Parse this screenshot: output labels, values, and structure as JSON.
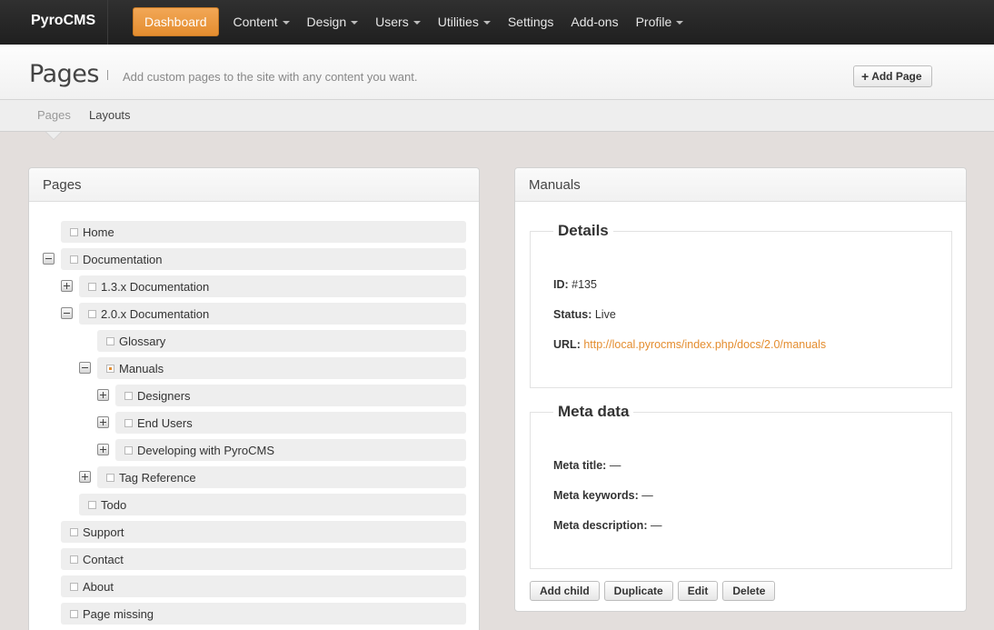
{
  "brand": "PyroCMS",
  "nav": [
    {
      "label": "Dashboard",
      "active": true,
      "caret": false
    },
    {
      "label": "Content",
      "caret": true
    },
    {
      "label": "Design",
      "caret": true
    },
    {
      "label": "Users",
      "caret": true
    },
    {
      "label": "Utilities",
      "caret": true
    },
    {
      "label": "Settings",
      "caret": false
    },
    {
      "label": "Add-ons",
      "caret": false
    },
    {
      "label": "Profile",
      "caret": true
    }
  ],
  "header": {
    "title": "Pages",
    "description": "Add custom pages to the site with any content you want.",
    "add_page_label": "Add Page"
  },
  "subnav": {
    "pages": "Pages",
    "layouts": "Layouts"
  },
  "tree_panel": {
    "title": "Pages",
    "items": [
      {
        "label": "Home",
        "level": 0
      },
      {
        "label": "Documentation",
        "level": 0,
        "toggle": "minus"
      },
      {
        "label": "1.3.x Documentation",
        "level": 1,
        "toggle": "plus"
      },
      {
        "label": "2.0.x Documentation",
        "level": 1,
        "toggle": "minus"
      },
      {
        "label": "Glossary",
        "level": 2
      },
      {
        "label": "Manuals",
        "level": 2,
        "toggle": "minus",
        "selected": true
      },
      {
        "label": "Designers",
        "level": 3,
        "toggle": "plus"
      },
      {
        "label": "End Users",
        "level": 3,
        "toggle": "plus"
      },
      {
        "label": "Developing with PyroCMS",
        "level": 3,
        "toggle": "plus"
      },
      {
        "label": "Tag Reference",
        "level": 2,
        "toggle": "plus"
      },
      {
        "label": "Todo",
        "level": 1
      },
      {
        "label": "Support",
        "level": 0
      },
      {
        "label": "Contact",
        "level": 0
      },
      {
        "label": "About",
        "level": 0
      },
      {
        "label": "Page missing",
        "level": 0
      }
    ]
  },
  "detail_panel": {
    "title": "Manuals",
    "details_legend": "Details",
    "id_label": "ID:",
    "id_value": "#135",
    "status_label": "Status:",
    "status_value": "Live",
    "url_label": "URL:",
    "url_value": "http://local.pyrocms/index.php/docs/2.0/manuals",
    "meta_legend": "Meta data",
    "meta_title_label": "Meta title:",
    "meta_title_value": "—",
    "meta_keywords_label": "Meta keywords:",
    "meta_keywords_value": "—",
    "meta_description_label": "Meta description:",
    "meta_description_value": "—",
    "buttons": {
      "add_child": "Add child",
      "duplicate": "Duplicate",
      "edit": "Edit",
      "delete": "Delete"
    }
  },
  "colors": {
    "accent": "#e48d2f",
    "topbar": "#262626",
    "background": "#e3dedc"
  }
}
